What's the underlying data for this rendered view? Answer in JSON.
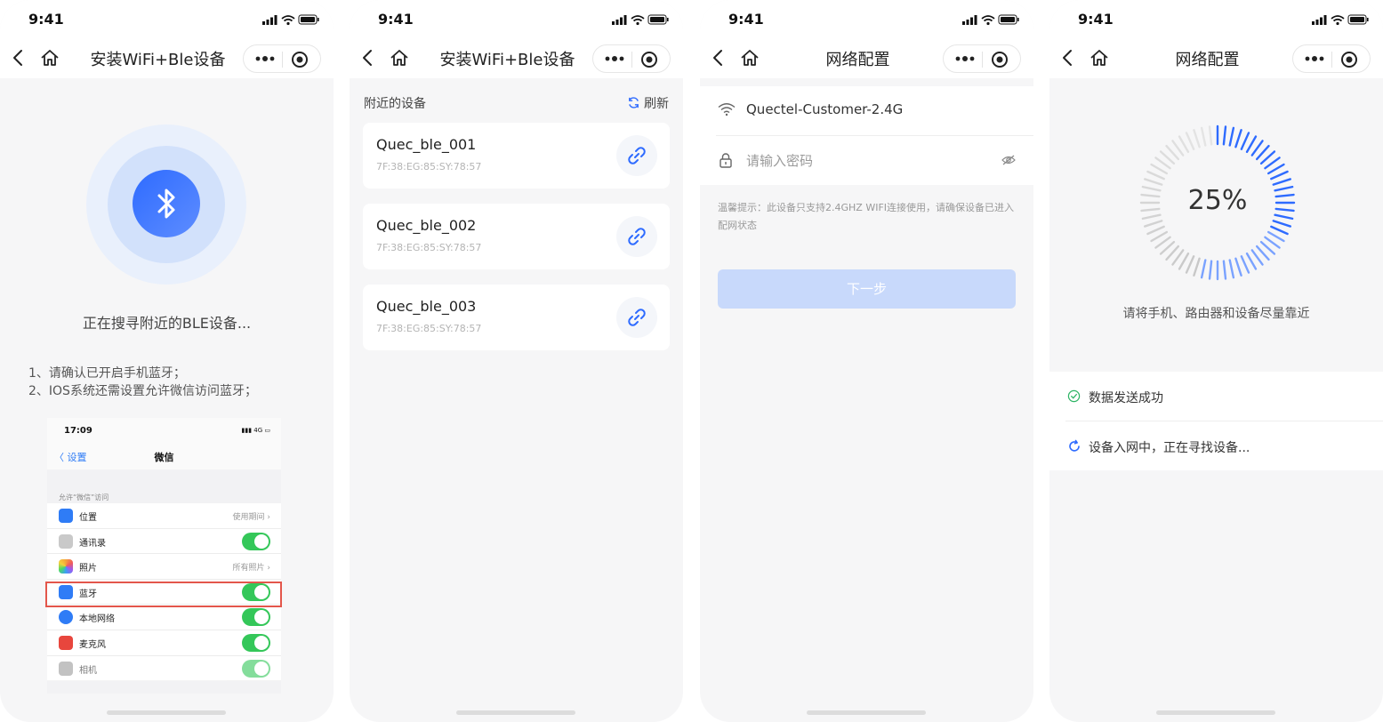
{
  "status": {
    "time": "9:41"
  },
  "screens": {
    "scan": {
      "title": "安装WiFi+Ble设备",
      "searching_text": "正在搜寻附近的BLE设备...",
      "tips": [
        "1、请确认已开启手机蓝牙；",
        "2、IOS系统还需设置允许微信访问蓝牙；"
      ],
      "ios_settings": {
        "time": "17:09",
        "signal": "4G",
        "back_label": "设置",
        "title": "微信",
        "section_header": "允许“微信”访问",
        "rows": [
          {
            "label": "位置",
            "value": "使用期间",
            "icon_color": "#2f7cf6",
            "icon": "location-icon"
          },
          {
            "label": "通讯录",
            "toggle": "on",
            "icon_color": "#c9c9c9",
            "icon": "contacts-icon"
          },
          {
            "label": "照片",
            "value": "所有照片",
            "icon_color": "#f4a33a",
            "icon": "photos-icon"
          },
          {
            "label": "蓝牙",
            "toggle": "on",
            "icon_color": "#2f7cf6",
            "icon": "bluetooth-icon"
          },
          {
            "label": "本地网络",
            "toggle": "on",
            "icon_color": "#2f7cf6",
            "icon": "globe-icon"
          },
          {
            "label": "麦克风",
            "toggle": "on",
            "icon_color": "#e8463d",
            "icon": "microphone-icon"
          },
          {
            "label": "相机",
            "toggle": "on",
            "icon_color": "#9a9a9a",
            "icon": "camera-icon"
          }
        ],
        "highlight_color": "#e3564b"
      }
    },
    "devices": {
      "title": "安装WiFi+Ble设备",
      "section_title": "附近的设备",
      "refresh_label": "刷新",
      "items": [
        {
          "name": "Quec_ble_001",
          "mac": "7F:38:EG:85:SY:78:57"
        },
        {
          "name": "Quec_ble_002",
          "mac": "7F:38:EG:85:SY:78:57"
        },
        {
          "name": "Quec_ble_003",
          "mac": "7F:38:EG:85:SY:78:57"
        }
      ]
    },
    "network": {
      "title": "网络配置",
      "ssid": "Quectel-Customer-2.4G",
      "password_placeholder": "请输入密码",
      "hint": "温馨提示：此设备只支持2.4GHZ WIFI连接使用，请确保设备已进入配网状态",
      "next_label": "下一步"
    },
    "progress": {
      "title": "网络配置",
      "percent_text": "25%",
      "percent": 0.25,
      "tip": "请将手机、路由器和设备尽量靠近",
      "steps": [
        {
          "text": "数据发送成功",
          "state": "done",
          "icon": "check-circle-icon"
        },
        {
          "text": "设备入网中，正在寻找设备...",
          "state": "loading",
          "icon": "refresh-icon"
        }
      ]
    }
  },
  "colors": {
    "accent": "#2e6bff",
    "success": "#2db464",
    "disabled_button": "#c8d9fb"
  }
}
